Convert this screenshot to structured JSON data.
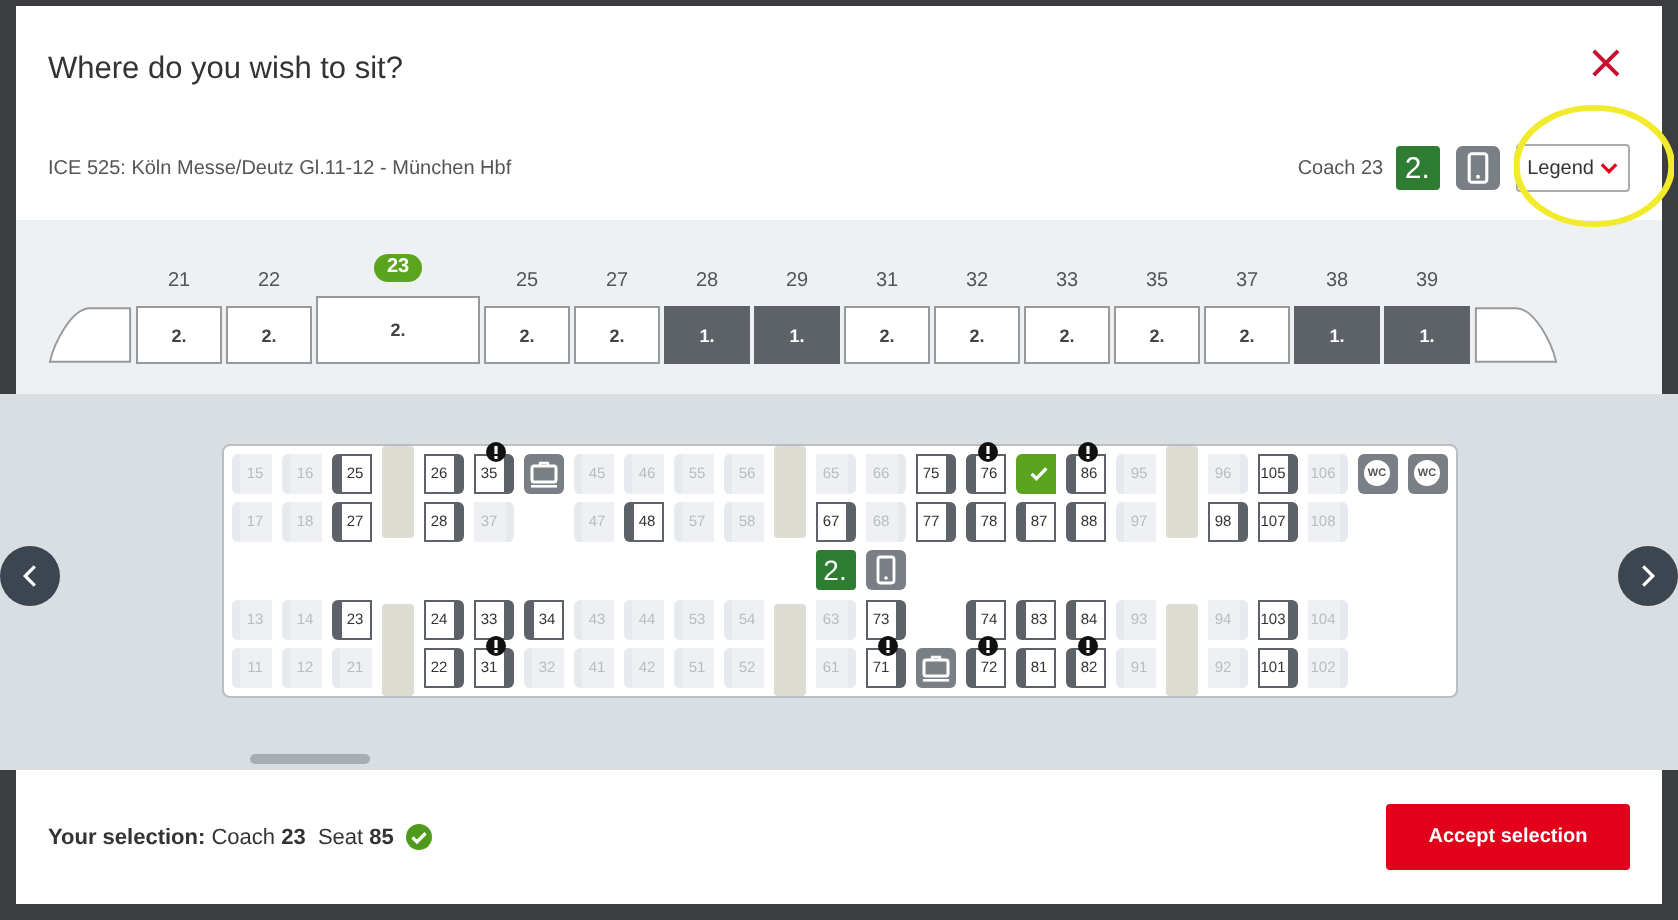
{
  "dialog": {
    "title": "Where do you wish to sit?",
    "close": "×"
  },
  "route": "ICE 525: Köln Messe/Deutz Gl.11-12 - München Hbf",
  "coach_info": {
    "label": "Coach 23",
    "class": "2."
  },
  "legend_button": {
    "label": "Legend",
    "expanded": false
  },
  "annotation": {
    "kind": "highlight-circle"
  },
  "coaches": [
    {
      "number": "21",
      "class": "2.",
      "selected": false
    },
    {
      "number": "22",
      "class": "2.",
      "selected": false
    },
    {
      "number": "23",
      "class": "2.",
      "selected": true
    },
    {
      "number": "25",
      "class": "2.",
      "selected": false
    },
    {
      "number": "27",
      "class": "2.",
      "selected": false
    },
    {
      "number": "28",
      "class": "1.",
      "selected": false
    },
    {
      "number": "29",
      "class": "1.",
      "selected": false
    },
    {
      "number": "31",
      "class": "2.",
      "selected": false
    },
    {
      "number": "32",
      "class": "2.",
      "selected": false
    },
    {
      "number": "33",
      "class": "2.",
      "selected": false
    },
    {
      "number": "35",
      "class": "2.",
      "selected": false
    },
    {
      "number": "37",
      "class": "2.",
      "selected": false
    },
    {
      "number": "38",
      "class": "1.",
      "selected": false
    },
    {
      "number": "39",
      "class": "1.",
      "selected": false
    }
  ],
  "sections": [
    {
      "rows": [
        [
          {
            "kind": "seat",
            "number": "15",
            "available": false,
            "selected": false,
            "info": false,
            "back_right": false
          },
          {
            "kind": "seat",
            "number": "16",
            "available": false,
            "selected": false,
            "info": false,
            "back_right": false
          },
          {
            "kind": "seat",
            "number": "25",
            "available": true,
            "selected": false,
            "info": false,
            "back_right": false
          }
        ],
        [
          {
            "kind": "seat",
            "number": "17",
            "available": false,
            "selected": false,
            "info": false,
            "back_right": false
          },
          {
            "kind": "seat",
            "number": "18",
            "available": false,
            "selected": false,
            "info": false,
            "back_right": false
          },
          {
            "kind": "seat",
            "number": "27",
            "available": true,
            "selected": false,
            "info": false,
            "back_right": false
          }
        ],
        [
          {
            "kind": "seat",
            "number": "13",
            "available": false,
            "selected": false,
            "info": false,
            "back_right": false
          },
          {
            "kind": "seat",
            "number": "14",
            "available": false,
            "selected": false,
            "info": false,
            "back_right": false
          },
          {
            "kind": "seat",
            "number": "23",
            "available": true,
            "selected": false,
            "info": false,
            "back_right": false
          }
        ],
        [
          {
            "kind": "seat",
            "number": "11",
            "available": false,
            "selected": false,
            "info": false,
            "back_right": false
          },
          {
            "kind": "seat",
            "number": "12",
            "available": false,
            "selected": false,
            "info": false,
            "back_right": false
          },
          {
            "kind": "seat",
            "number": "21",
            "available": false,
            "selected": false,
            "info": false,
            "back_right": false
          }
        ]
      ]
    },
    {
      "rows": [
        [
          {
            "kind": "seat",
            "number": "26",
            "available": true,
            "selected": false,
            "info": false,
            "back_right": true
          },
          {
            "kind": "seat",
            "number": "35",
            "available": true,
            "selected": false,
            "info": true,
            "back_right": true
          },
          {
            "kind": "luggage"
          },
          {
            "kind": "seat",
            "number": "45",
            "available": false,
            "selected": false,
            "info": false,
            "back_right": false
          },
          {
            "kind": "seat",
            "number": "46",
            "available": false,
            "selected": false,
            "info": false,
            "back_right": false
          },
          {
            "kind": "seat",
            "number": "55",
            "available": false,
            "selected": false,
            "info": false,
            "back_right": false
          },
          {
            "kind": "seat",
            "number": "56",
            "available": false,
            "selected": false,
            "info": false,
            "back_right": false
          }
        ],
        [
          {
            "kind": "seat",
            "number": "28",
            "available": true,
            "selected": false,
            "info": false,
            "back_right": true
          },
          {
            "kind": "seat",
            "number": "37",
            "available": false,
            "selected": false,
            "info": false,
            "back_right": true
          },
          {
            "kind": "empty"
          },
          {
            "kind": "seat",
            "number": "47",
            "available": false,
            "selected": false,
            "info": false,
            "back_right": false
          },
          {
            "kind": "seat",
            "number": "48",
            "available": true,
            "selected": false,
            "info": false,
            "back_right": false
          },
          {
            "kind": "seat",
            "number": "57",
            "available": false,
            "selected": false,
            "info": false,
            "back_right": false
          },
          {
            "kind": "seat",
            "number": "58",
            "available": false,
            "selected": false,
            "info": false,
            "back_right": false
          }
        ],
        [
          {
            "kind": "seat",
            "number": "24",
            "available": true,
            "selected": false,
            "info": false,
            "back_right": true
          },
          {
            "kind": "seat",
            "number": "33",
            "available": true,
            "selected": false,
            "info": false,
            "back_right": true
          },
          {
            "kind": "seat",
            "number": "34",
            "available": true,
            "selected": false,
            "info": false,
            "back_right": false
          },
          {
            "kind": "seat",
            "number": "43",
            "available": false,
            "selected": false,
            "info": false,
            "back_right": false
          },
          {
            "kind": "seat",
            "number": "44",
            "available": false,
            "selected": false,
            "info": false,
            "back_right": false
          },
          {
            "kind": "seat",
            "number": "53",
            "available": false,
            "selected": false,
            "info": false,
            "back_right": false
          },
          {
            "kind": "seat",
            "number": "54",
            "available": false,
            "selected": false,
            "info": false,
            "back_right": false
          }
        ],
        [
          {
            "kind": "seat",
            "number": "22",
            "available": true,
            "selected": false,
            "info": false,
            "back_right": true
          },
          {
            "kind": "seat",
            "number": "31",
            "available": true,
            "selected": false,
            "info": true,
            "back_right": true
          },
          {
            "kind": "seat",
            "number": "32",
            "available": false,
            "selected": false,
            "info": false,
            "back_right": false
          },
          {
            "kind": "seat",
            "number": "41",
            "available": false,
            "selected": false,
            "info": false,
            "back_right": false
          },
          {
            "kind": "seat",
            "number": "42",
            "available": false,
            "selected": false,
            "info": false,
            "back_right": false
          },
          {
            "kind": "seat",
            "number": "51",
            "available": false,
            "selected": false,
            "info": false,
            "back_right": false
          },
          {
            "kind": "seat",
            "number": "52",
            "available": false,
            "selected": false,
            "info": false,
            "back_right": false
          }
        ]
      ]
    },
    {
      "aisle": [
        {
          "kind": "class",
          "label": "2."
        },
        {
          "kind": "phone"
        }
      ],
      "rows": [
        [
          {
            "kind": "seat",
            "number": "65",
            "available": false,
            "selected": false,
            "info": false,
            "back_right": true
          },
          {
            "kind": "seat",
            "number": "66",
            "available": false,
            "selected": false,
            "info": false,
            "back_right": true
          },
          {
            "kind": "seat",
            "number": "75",
            "available": true,
            "selected": false,
            "info": false,
            "back_right": true
          },
          {
            "kind": "seat",
            "number": "76",
            "available": true,
            "selected": false,
            "info": true,
            "back_right": false
          },
          {
            "kind": "seat",
            "selected": true,
            "available": true,
            "info": false,
            "back_right": false
          },
          {
            "kind": "seat",
            "number": "86",
            "available": true,
            "selected": false,
            "info": true,
            "back_right": false
          },
          {
            "kind": "seat",
            "number": "95",
            "available": false,
            "selected": false,
            "info": false,
            "back_right": false
          }
        ],
        [
          {
            "kind": "seat",
            "number": "67",
            "available": true,
            "selected": false,
            "info": false,
            "back_right": true
          },
          {
            "kind": "seat",
            "number": "68",
            "available": false,
            "selected": false,
            "info": false,
            "back_right": true
          },
          {
            "kind": "seat",
            "number": "77",
            "available": true,
            "selected": false,
            "info": false,
            "back_right": true
          },
          {
            "kind": "seat",
            "number": "78",
            "available": true,
            "selected": false,
            "info": false,
            "back_right": false
          },
          {
            "kind": "seat",
            "number": "87",
            "available": true,
            "selected": false,
            "info": false,
            "back_right": false
          },
          {
            "kind": "seat",
            "number": "88",
            "available": true,
            "selected": false,
            "info": false,
            "back_right": false
          },
          {
            "kind": "seat",
            "number": "97",
            "available": false,
            "selected": false,
            "info": false,
            "back_right": false
          }
        ],
        [
          {
            "kind": "seat",
            "number": "63",
            "available": false,
            "selected": false,
            "info": false,
            "back_right": true
          },
          {
            "kind": "seat",
            "number": "73",
            "available": true,
            "selected": false,
            "info": false,
            "back_right": true
          },
          {
            "kind": "empty"
          },
          {
            "kind": "seat",
            "number": "74",
            "available": true,
            "selected": false,
            "info": false,
            "back_right": false
          },
          {
            "kind": "seat",
            "number": "83",
            "available": true,
            "selected": false,
            "info": false,
            "back_right": false
          },
          {
            "kind": "seat",
            "number": "84",
            "available": true,
            "selected": false,
            "info": false,
            "back_right": false
          },
          {
            "kind": "seat",
            "number": "93",
            "available": false,
            "selected": false,
            "info": false,
            "back_right": false
          }
        ],
        [
          {
            "kind": "seat",
            "number": "61",
            "available": false,
            "selected": false,
            "info": false,
            "back_right": true
          },
          {
            "kind": "seat",
            "number": "71",
            "available": true,
            "selected": false,
            "info": true,
            "back_right": true
          },
          {
            "kind": "luggage"
          },
          {
            "kind": "seat",
            "number": "72",
            "available": true,
            "selected": false,
            "info": true,
            "back_right": false
          },
          {
            "kind": "seat",
            "number": "81",
            "available": true,
            "selected": false,
            "info": false,
            "back_right": false
          },
          {
            "kind": "seat",
            "number": "82",
            "available": true,
            "selected": false,
            "info": true,
            "back_right": false
          },
          {
            "kind": "seat",
            "number": "91",
            "available": false,
            "selected": false,
            "info": false,
            "back_right": false
          }
        ]
      ]
    },
    {
      "rows": [
        [
          {
            "kind": "seat",
            "number": "96",
            "available": false,
            "selected": false,
            "info": false,
            "back_right": true
          },
          {
            "kind": "seat",
            "number": "105",
            "available": true,
            "selected": false,
            "info": false,
            "back_right": true
          },
          {
            "kind": "seat",
            "number": "106",
            "available": false,
            "selected": false,
            "info": false,
            "back_right": true
          },
          {
            "kind": "wc",
            "label": "WC"
          },
          {
            "kind": "wc",
            "label": "WC"
          }
        ],
        [
          {
            "kind": "seat",
            "number": "98",
            "available": true,
            "selected": false,
            "info": false,
            "back_right": true
          },
          {
            "kind": "seat",
            "number": "107",
            "available": true,
            "selected": false,
            "info": false,
            "back_right": true
          },
          {
            "kind": "seat",
            "number": "108",
            "available": false,
            "selected": false,
            "info": false,
            "back_right": true
          },
          {
            "kind": "empty"
          },
          {
            "kind": "empty"
          }
        ],
        [
          {
            "kind": "seat",
            "number": "94",
            "available": false,
            "selected": false,
            "info": false,
            "back_right": true
          },
          {
            "kind": "seat",
            "number": "103",
            "available": true,
            "selected": false,
            "info": false,
            "back_right": true
          },
          {
            "kind": "seat",
            "number": "104",
            "available": false,
            "selected": false,
            "info": false,
            "back_right": true
          },
          {
            "kind": "empty"
          },
          {
            "kind": "empty"
          }
        ],
        [
          {
            "kind": "seat",
            "number": "92",
            "available": false,
            "selected": false,
            "info": false,
            "back_right": true
          },
          {
            "kind": "seat",
            "number": "101",
            "available": true,
            "selected": false,
            "info": false,
            "back_right": true
          },
          {
            "kind": "seat",
            "number": "102",
            "available": false,
            "selected": false,
            "info": false,
            "back_right": true
          },
          {
            "kind": "empty"
          },
          {
            "kind": "empty"
          }
        ]
      ]
    }
  ],
  "selection": "**Your selection:** Coach **23**  Seat **85**",
  "accept_button": "Accept selection"
}
